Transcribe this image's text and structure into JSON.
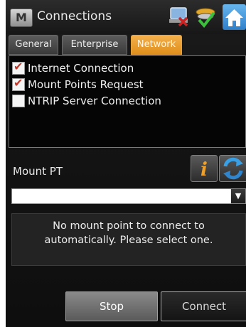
{
  "window": {
    "title": "Connections",
    "app_icon_letter": "M"
  },
  "toolbar_icons": [
    "device-status-icon",
    "satellite-icon",
    "home-icon"
  ],
  "tabs": [
    {
      "label": "General",
      "active": false
    },
    {
      "label": "Enterprise",
      "active": false
    },
    {
      "label": "Network",
      "active": true
    }
  ],
  "options": [
    {
      "label": "Internet Connection",
      "checked": true
    },
    {
      "label": "Mount Points Request",
      "checked": true
    },
    {
      "label": "NTRIP Server Connection",
      "checked": false
    }
  ],
  "mount_point": {
    "label": "Mount PT",
    "selected": "",
    "message": "No mount point to connect to automatically. Please select one."
  },
  "buttons": {
    "stop": "Stop",
    "connect": "Connect"
  },
  "colors": {
    "active_tab": "#e8991f",
    "check_mark": "#c0392b"
  }
}
